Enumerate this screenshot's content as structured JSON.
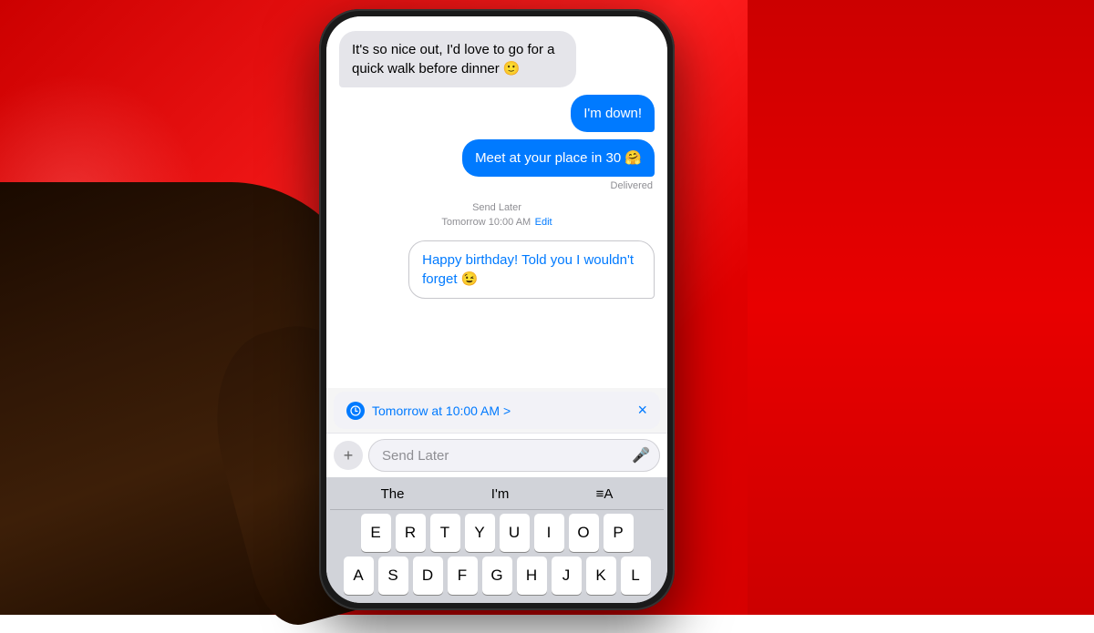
{
  "background": {
    "color_left": "#cc0000",
    "color_right": "#e00000"
  },
  "phone": {
    "messages": [
      {
        "id": "msg1",
        "type": "received",
        "text": "It's so nice out, I'd love to go for a quick walk before dinner 🙂"
      },
      {
        "id": "msg2",
        "type": "sent",
        "text": "I'm down!"
      },
      {
        "id": "msg3",
        "type": "sent",
        "text": "Meet at your place in 30 🤗"
      },
      {
        "id": "msg4",
        "type": "delivered",
        "text": "Delivered"
      },
      {
        "id": "msg5",
        "type": "send_later_label",
        "title": "Send Later",
        "time": "Tomorrow 10:00 AM",
        "edit_label": "Edit"
      },
      {
        "id": "msg6",
        "type": "scheduled",
        "text": "Happy birthday! Told you I wouldn't forget 😉"
      }
    ],
    "schedule_bar": {
      "time_label": "Tomorrow at 10:00 AM >",
      "close_label": "×"
    },
    "input": {
      "placeholder": "Send Later"
    },
    "keyboard": {
      "suggestions": [
        "The",
        "I'm",
        "≡A"
      ],
      "row1": [
        "E",
        "R",
        "T",
        "Y",
        "U",
        "I",
        "O",
        "P"
      ],
      "row2": [
        "A",
        "S",
        "D",
        "F",
        "G",
        "H",
        "J",
        "K",
        "L"
      ]
    }
  }
}
